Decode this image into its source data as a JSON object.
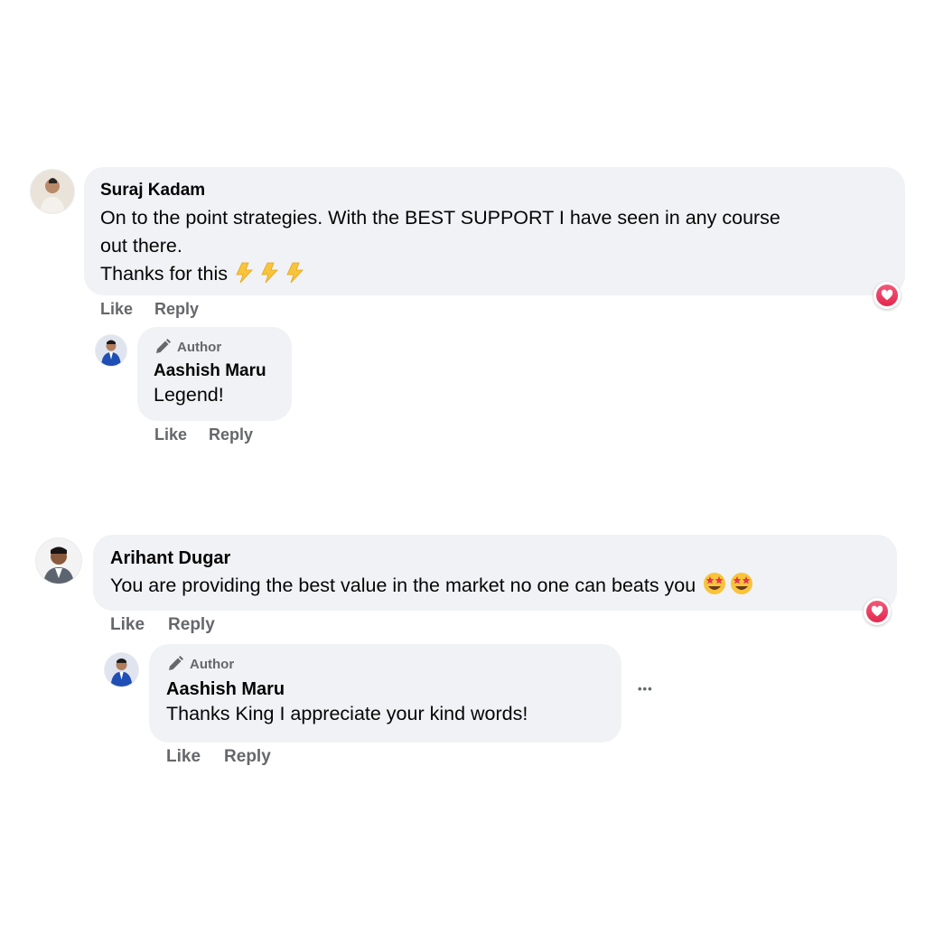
{
  "comments": [
    {
      "author": "Suraj Kadam",
      "text_line1": "On to the point strategies. With the BEST SUPPORT I have seen in any course",
      "text_line2": "out there.",
      "text_line3": "Thanks for this",
      "emoji": "lightning-bolt x3",
      "reaction": "heart",
      "actions": {
        "like": "Like",
        "reply": "Reply"
      },
      "reply": {
        "badge": "Author",
        "author": "Aashish Maru",
        "text": "Legend!",
        "actions": {
          "like": "Like",
          "reply": "Reply"
        }
      }
    },
    {
      "author": "Arihant Dugar",
      "text": "You are providing the best value in the market no one can beats you",
      "emoji": "star-struck x2",
      "reaction": "heart",
      "actions": {
        "like": "Like",
        "reply": "Reply"
      },
      "reply": {
        "badge": "Author",
        "author": "Aashish Maru",
        "text": "Thanks King I appreciate your kind words!",
        "more": "•••",
        "actions": {
          "like": "Like",
          "reply": "Reply"
        }
      }
    }
  ],
  "colors": {
    "bubble": "#f0f2f5",
    "muted_text": "#65676b",
    "heart": "#e3284e"
  }
}
